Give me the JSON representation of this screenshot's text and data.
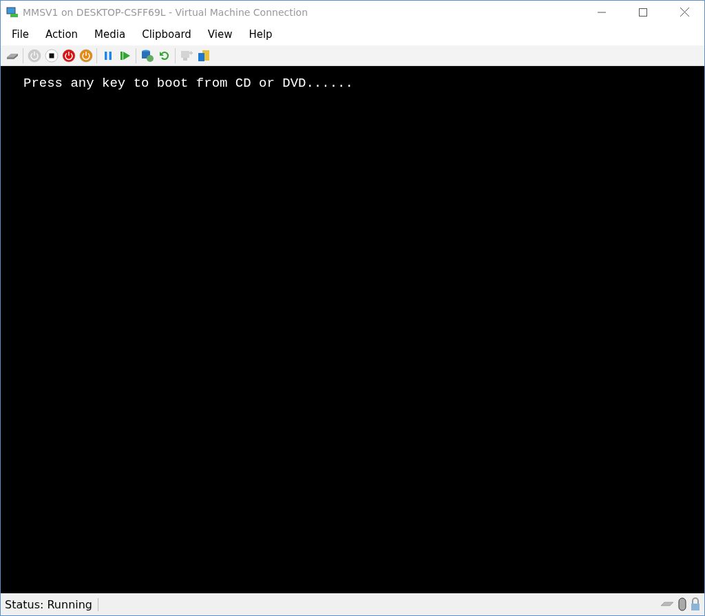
{
  "window": {
    "title": "MMSV1 on DESKTOP-CSFF69L - Virtual Machine Connection",
    "active": false
  },
  "menu": [
    "File",
    "Action",
    "Media",
    "Clipboard",
    "View",
    "Help"
  ],
  "toolbar": [
    {
      "kind": "ctrl-alt-del",
      "disabled": false
    },
    {
      "kind": "separator"
    },
    {
      "kind": "start",
      "disabled": true
    },
    {
      "kind": "turn-off",
      "disabled": false
    },
    {
      "kind": "shut-down",
      "disabled": false
    },
    {
      "kind": "save",
      "disabled": false
    },
    {
      "kind": "separator"
    },
    {
      "kind": "pause",
      "disabled": false
    },
    {
      "kind": "resume",
      "disabled": false
    },
    {
      "kind": "separator"
    },
    {
      "kind": "checkpoint",
      "disabled": false
    },
    {
      "kind": "revert",
      "disabled": false
    },
    {
      "kind": "separator"
    },
    {
      "kind": "enhanced",
      "disabled": true
    },
    {
      "kind": "share",
      "disabled": false
    }
  ],
  "console": {
    "lines": [
      "Press any key to boot from CD or DVD......"
    ]
  },
  "status_bar": {
    "text": "Status: Running"
  }
}
